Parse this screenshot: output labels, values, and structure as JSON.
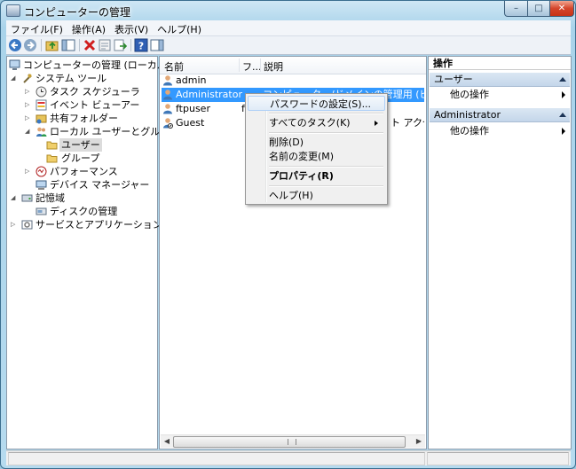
{
  "window": {
    "title": "コンピューターの管理",
    "min_label": "–",
    "max_label": "□",
    "close_label": "✕"
  },
  "menubar": [
    "ファイル(F)",
    "操作(A)",
    "表示(V)",
    "ヘルプ(H)"
  ],
  "tree": {
    "root": "コンピューターの管理 (ローカル)",
    "system_tools": "システム ツール",
    "task_scheduler": "タスク スケジューラ",
    "event_viewer": "イベント ビューアー",
    "shared_folders": "共有フォルダー",
    "local_users_groups": "ローカル ユーザーとグループ",
    "users": "ユーザー",
    "groups": "グループ",
    "performance": "パフォーマンス",
    "device_manager": "デバイス マネージャー",
    "storage": "記憶域",
    "disk_management": "ディスクの管理",
    "services_apps": "サービスとアプリケーション"
  },
  "list": {
    "columns": {
      "name": "名前",
      "fullname": "フ...",
      "description": "説明"
    },
    "rows": [
      {
        "name": "admin",
        "fullname": "",
        "description": ""
      },
      {
        "name": "Administrator",
        "fullname": "",
        "description": "コンピューター/ドメインの管理用 (ビルトイ"
      },
      {
        "name": "ftpuser",
        "fullname": "f",
        "description": ""
      },
      {
        "name": "Guest",
        "fullname": "",
        "description": "ト アクセス"
      }
    ]
  },
  "context_menu": {
    "set_password": "パスワードの設定(S)...",
    "all_tasks": "すべてのタスク(K)",
    "delete": "削除(D)",
    "rename": "名前の変更(M)",
    "properties": "プロパティ(R)",
    "help": "ヘルプ(H)"
  },
  "actions": {
    "title": "操作",
    "section1": "ユーザー",
    "section1_item": "他の操作",
    "section2": "Administrator",
    "section2_item": "他の操作"
  },
  "colors": {
    "selection": "#3399ff",
    "tree_selection": "#dcdcdc",
    "close_red": "#c73316"
  }
}
